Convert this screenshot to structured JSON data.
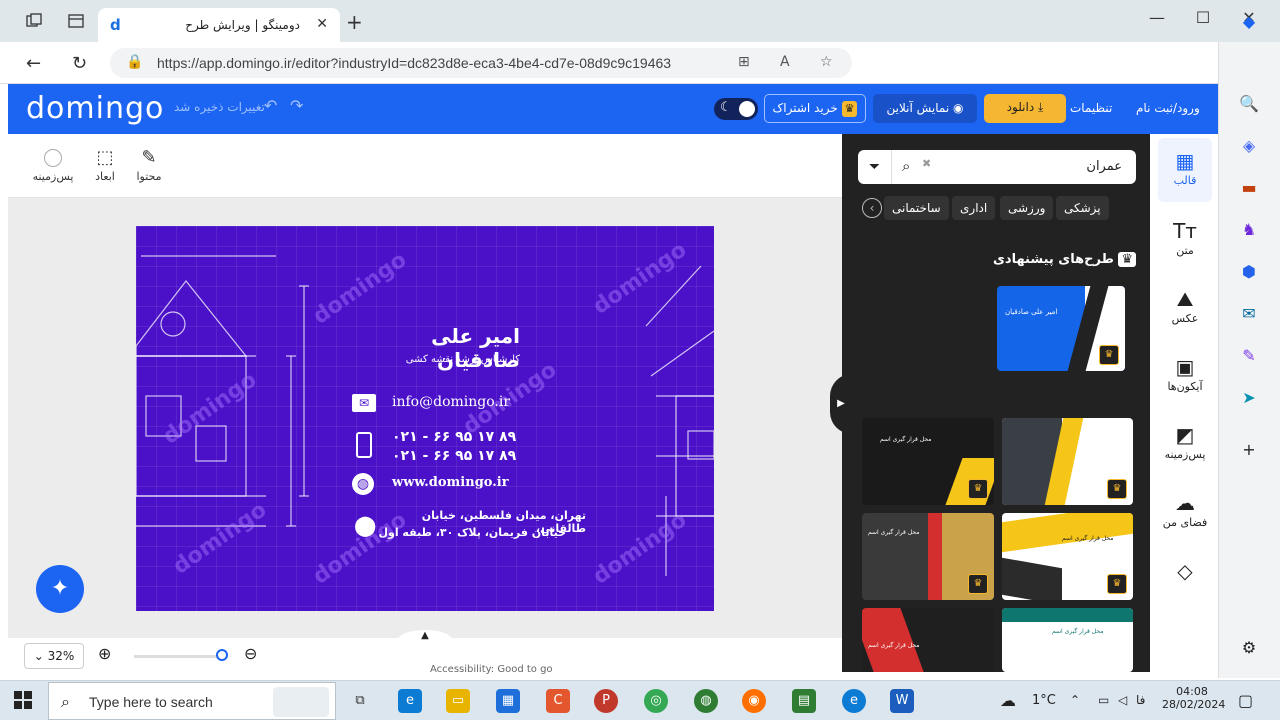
{
  "browser": {
    "tab_title": "دومینگو | ویرایش طرح",
    "url": "https://app.domingo.ir/editor?industryId=dc823d8e-eca3-4be4-cd7e-08d9c9c19463"
  },
  "header": {
    "logo": "domingo",
    "saved_text": "تغییرات ذخیره شد",
    "subscribe_label": "خرید اشتراک",
    "online_label": "نمایش آنلاین",
    "download_label": "دانلود",
    "settings_label": "تنظیمات",
    "login_label": "ورود/ثبت نام"
  },
  "toolbar": {
    "content_label": "محتوا",
    "dimensions_label": "ابعاد",
    "background_label": "پس‌زمینه"
  },
  "card": {
    "watermark": "domingo",
    "name": "امیر علی صادقیان",
    "job": "کارشناس ارشد نقشه کشی",
    "email": "info@domingo.ir",
    "phone1": "۰۲۱ - ۶۶ ۹۵ ۱۷ ۸۹",
    "phone2": "۰۲۱ - ۶۶ ۹۵ ۱۷ ۸۹",
    "website": "www.domingo.ir",
    "address1": "تهران، میدان فلسطین، خیابان طالقانی،",
    "address2": "خیابان فریمان، پلاک ۳۰، طبقه اول"
  },
  "zoom": {
    "value": "32%"
  },
  "bottom_status": "Accessibility: Good to go",
  "panel": {
    "search_value": "عمران",
    "chips": [
      "پزشکی",
      "ورزشی",
      "اداری",
      "ساختمانی"
    ],
    "suggested_title": "طرح‌های پیشنهادی",
    "thumb_texts": {
      "t1_name": "امیر علی صادقیان",
      "placeholder": "محل قرار گیری اسم"
    }
  },
  "nav": {
    "template": "قالب",
    "text": "متن",
    "photo": "عکس",
    "icons": "آیکون‌ها",
    "background": "پس‌زمینه",
    "myspace": "فضای من"
  },
  "taskbar": {
    "search_placeholder": "Type here to search",
    "temperature": "1°C",
    "lang": "فا",
    "time": "04:08",
    "date": "28/02/2024"
  },
  "colors": {
    "brand": "#1c64f2",
    "card": "#4b11c8",
    "premium": "#f6b82c"
  }
}
